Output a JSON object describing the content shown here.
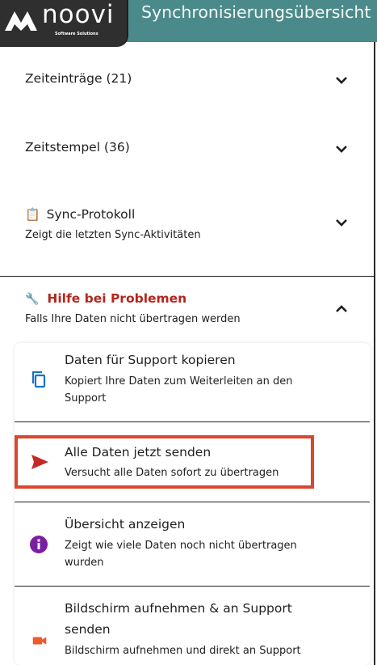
{
  "header": {
    "logo_text": "noovi",
    "logo_sub": "Software Solutions",
    "title": "Synchronisierungsübersicht"
  },
  "sections": {
    "entries": {
      "title": "Zeiteinträge (21)",
      "icon": "chevron-down-icon"
    },
    "stamps": {
      "title": "Zeitstempel (36)",
      "icon": "chevron-down-icon"
    },
    "protocol": {
      "emoji": "📋",
      "title": "Sync-Protokoll",
      "subtitle": "Zeigt die letzten Sync-Aktivitäten",
      "icon": "chevron-down-icon"
    },
    "help": {
      "emoji": "🔧",
      "title": "Hilfe bei Problemen",
      "subtitle": "Falls Ihre Daten nicht übertragen werden",
      "icon": "chevron-up-icon",
      "title_color": "#b3261e"
    }
  },
  "help_items": [
    {
      "title": "Daten für Support kopieren",
      "subtitle_line1": "Kopiert Ihre Daten zum Weiterleiten an den",
      "subtitle_line2": "Support",
      "icon": "copy-icon",
      "color": "#1a73c7"
    },
    {
      "title": "Alle Daten jetzt senden",
      "subtitle_line1": "Versucht alle Daten sofort zu übertragen",
      "icon": "send-icon",
      "color": "#c62828"
    },
    {
      "title": "Übersicht anzeigen",
      "subtitle_line1": "Zeigt wie viele Daten noch nicht übertragen",
      "subtitle_line2": "wurden",
      "icon": "info-icon",
      "color": "#7b1fa2"
    },
    {
      "title_line1": "Bildschirm aufnehmen & an Support",
      "title_line2": "senden",
      "subtitle_line1": "Bildschirm aufnehmen und direkt an Support",
      "icon": "video-icon",
      "color": "#ef5a2a"
    }
  ],
  "colors": {
    "header_bg": "#4b8a8b",
    "logo_bg": "#2f2f2f",
    "highlight_border": "#d9472f"
  }
}
